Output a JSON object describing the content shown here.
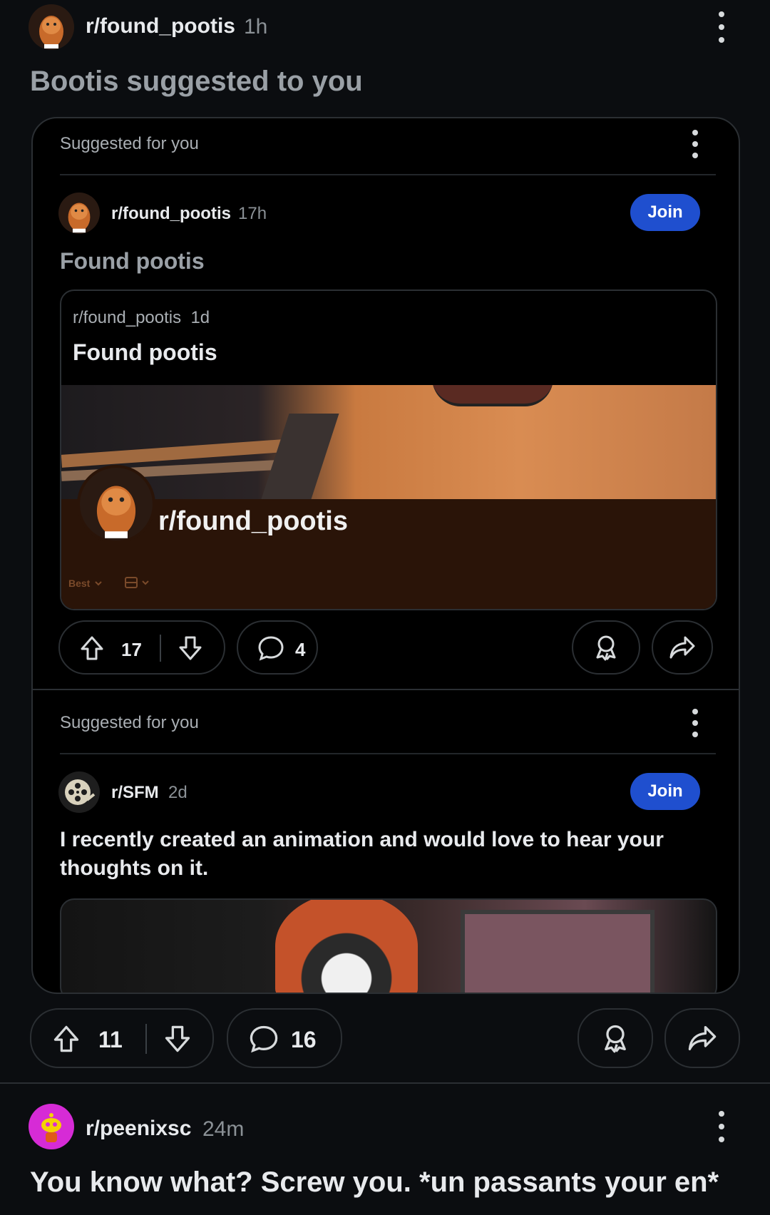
{
  "post": {
    "subreddit": "r/found_pootis",
    "time": "1h",
    "title": "Bootis suggested to you",
    "votes": "11",
    "comments": "16"
  },
  "embed1": {
    "header": "Suggested for you",
    "subreddit": "r/found_pootis",
    "time": "17h",
    "join_label": "Join",
    "title": "Found pootis",
    "crosspost": {
      "subreddit": "r/found_pootis",
      "time": "1d",
      "title": "Found pootis",
      "banner_sub_name": "r/found_pootis",
      "sort_label": "Best"
    },
    "votes": "17",
    "comments": "4"
  },
  "embed2": {
    "header": "Suggested for you",
    "subreddit": "r/SFM",
    "time": "2d",
    "join_label": "Join",
    "title": "I recently created an animation and would love to hear your thoughts on it."
  },
  "next_post": {
    "subreddit": "r/peenixsc",
    "time": "24m",
    "title": "You know what? Screw you. *un passants your en*"
  },
  "colors": {
    "bg": "#0b0d10",
    "card": "#000000",
    "join": "#1f4fcf",
    "pill_border": "#2b2f33"
  },
  "icons": [
    "subreddit-avatar-icon",
    "kebab-menu-icon",
    "upvote-icon",
    "downvote-icon",
    "comment-icon",
    "award-icon",
    "share-icon",
    "chevron-down-icon",
    "layout-icon",
    "film-reel-icon",
    "snoo-icon"
  ]
}
